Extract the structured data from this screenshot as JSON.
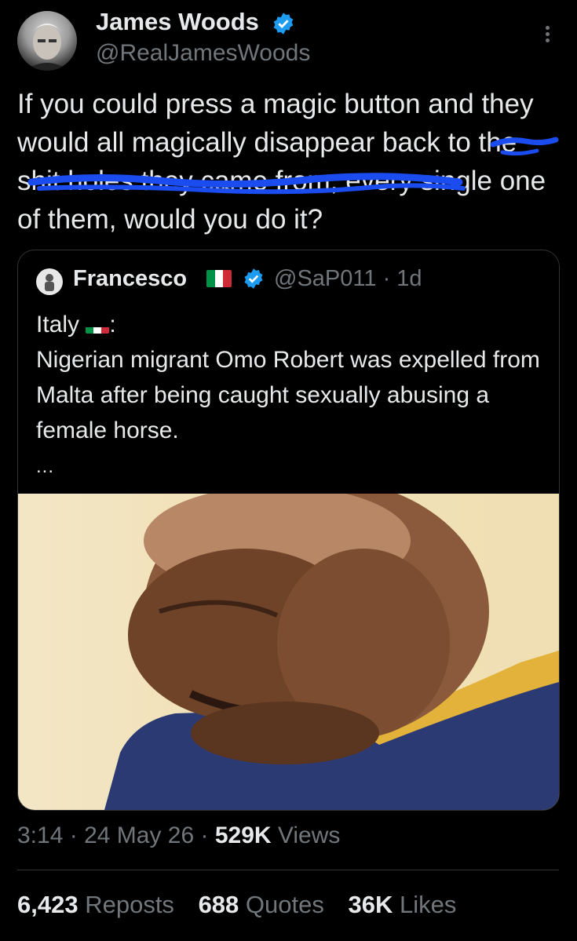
{
  "author": {
    "name": "James Woods",
    "handle": "@RealJamesWoods",
    "avatar_icon": "profile-photo"
  },
  "tweet": {
    "text_before": "If you could press a magic button and they would all magically disappear",
    "scribbled_text": "back to the shit holes they came from,",
    "text_after": "every single one of them, would you do it?"
  },
  "quoted": {
    "name": "Francesco",
    "handle": "@SaP011",
    "separator": "·",
    "age": "1d",
    "line1_prefix": "Italy",
    "line1_suffix": ":",
    "body": "Nigerian migrant Omo Robert was expelled from Malta after being caught sexually abusing a female horse.",
    "ellipsis": "...",
    "image_alt": "man looking down"
  },
  "meta": {
    "time": "3:14",
    "sep1": "·",
    "date": "24 May 26",
    "sep2": "·",
    "views_count": "529K",
    "views_label": "Views"
  },
  "stats": {
    "reposts_count": "6,423",
    "reposts_label": "Reposts",
    "quotes_count": "688",
    "quotes_label": "Quotes",
    "likes_count": "36K",
    "likes_label": "Likes"
  },
  "colors": {
    "background": "#000000",
    "text": "#e7e9ea",
    "secondary": "#71767b",
    "verified": "#1d9bf0",
    "scribble": "#1a4cf0"
  }
}
